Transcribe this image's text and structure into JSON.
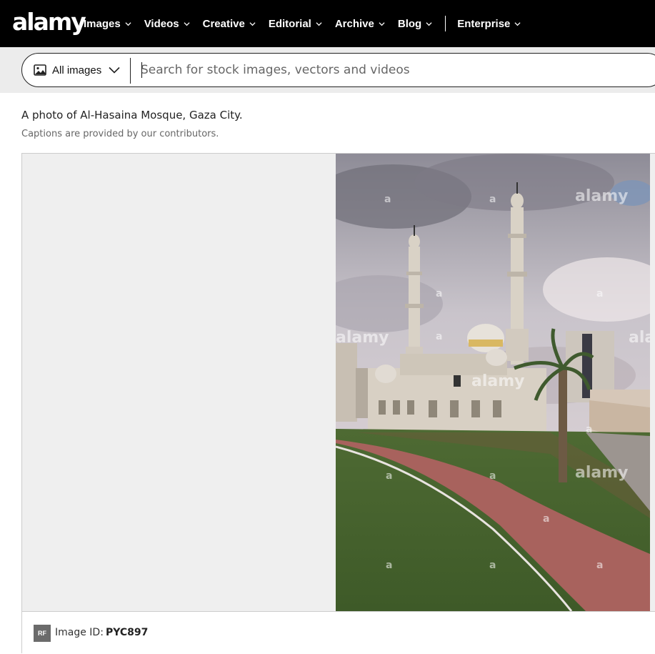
{
  "brand": {
    "logo_text": "alamy"
  },
  "nav": {
    "items": [
      {
        "label": "Images"
      },
      {
        "label": "Videos"
      },
      {
        "label": "Creative"
      },
      {
        "label": "Editorial"
      },
      {
        "label": "Archive"
      },
      {
        "label": "Blog"
      }
    ],
    "enterprise_label": "Enterprise"
  },
  "search": {
    "filter_label": "All images",
    "filter_icon": "image-icon",
    "placeholder": "Search for stock images, vectors and videos",
    "value": ""
  },
  "image": {
    "caption": "A photo of Al-Hasaina Mosque, Gaza City.",
    "caption_note": "Captions are provided by our contributors.",
    "watermark_text": "alamy",
    "watermark_letter": "a",
    "license_badge": "RF",
    "id_label": "Image ID:",
    "id_value": "PYC897"
  },
  "colors": {
    "nav_bg": "#000000",
    "search_band_bg": "#ececec",
    "viewer_pane_bg": "#efefef",
    "badge_bg": "#6b6b6b"
  }
}
